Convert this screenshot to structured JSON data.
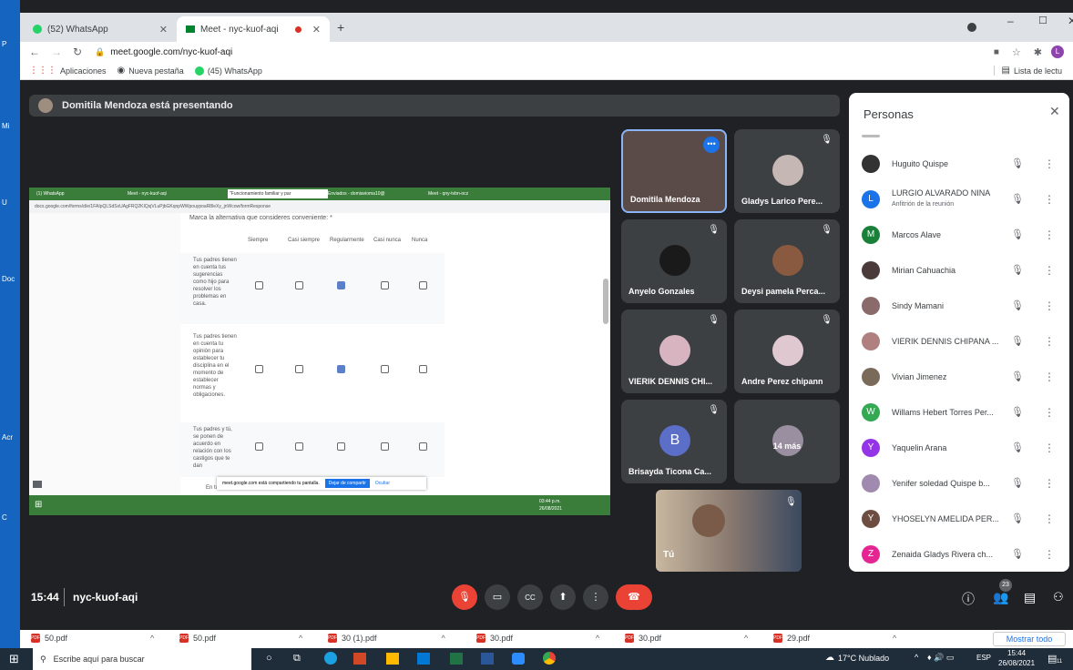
{
  "browser": {
    "tabs": [
      {
        "label": "(52) WhatsApp"
      },
      {
        "label": "Meet - nyc-kuof-aqi"
      }
    ],
    "url": "meet.google.com/nyc-kuof-aqi",
    "bookmarks": [
      "Aplicaciones",
      "Nueva pestaña",
      "(45) WhatsApp"
    ],
    "reading_list": "Lista de lectu"
  },
  "desktop_labels": [
    "P",
    "Mi",
    "U",
    "Doc",
    "Acr",
    "C"
  ],
  "meet": {
    "presenter_banner": "Domitila Mendoza está presentando",
    "meeting_time": "15:44",
    "meeting_code": "nyc-kuof-aqi",
    "participant_count": "23"
  },
  "shared_screen": {
    "tabs": [
      "(1) WhatsApp",
      "Meet - nyc-kuof-aqi",
      "\"Funcionamiento familiar y par",
      "Enviados - domiavioma10@",
      "Meet - qny-tvbn-ocz"
    ],
    "url": "docs.google.com/forms/d/e/1FAIpQLSdSxUAgFRQ2KIQsjVLuPjbGKqnpWWpouypoaR8leXy_jnWcow/formResponse",
    "question": "Marca la alternativa que consideres conveniente: *",
    "columns": [
      "Siempre",
      "Casi siempre",
      "Regularmente",
      "Casi nunca",
      "Nunca"
    ],
    "rows": [
      {
        "text": "Tus padres tienen en cuenta tus sugerencias como hijo para resolver los problemas en casa.",
        "selected": 2
      },
      {
        "text": "Tus padres tienen en cuenta tu opinión para establecer tu disciplina en el momento de establecer normas y obligaciones.",
        "selected": 2
      },
      {
        "text": "Tus padres y tú, se ponen de acuerdo en relación con los castigos que te dan",
        "selected": -1
      }
    ],
    "truncated_text": "En tu ca",
    "sharing_notice": "meet.google.com está compartiendo tu pantalla.",
    "stop_sharing": "Dejar de compartir",
    "hide": "Ocultar",
    "clock": "03:44 p.m.",
    "date": "26/08/2021"
  },
  "tiles": [
    {
      "name": "Domitila Mendoza",
      "col": 0,
      "row": 0,
      "color": "#5a4a48"
    },
    {
      "name": "Gladys Larico Pere...",
      "col": 1,
      "row": 0,
      "color": "#c5b8b4"
    },
    {
      "name": "Anyelo Gonzales",
      "col": 0,
      "row": 1,
      "color": "#1a1a1a"
    },
    {
      "name": "Deysi pamela Perca...",
      "col": 1,
      "row": 1,
      "color": "#8a5a40"
    },
    {
      "name": "VIERIK DENNIS CHI...",
      "col": 0,
      "row": 2,
      "color": "#d8b4c0"
    },
    {
      "name": "Andre Perez chipann",
      "col": 1,
      "row": 2,
      "color": "#e0c8d0"
    },
    {
      "name": "Brisayda Ticona Ca...",
      "col": 0,
      "row": 3,
      "color": "#5b6ec8",
      "initial": "B"
    },
    {
      "name": "14 más",
      "col": 1,
      "row": 3,
      "color": "#9a8fa0"
    }
  ],
  "self_tile": {
    "name": "Tú"
  },
  "people_panel": {
    "title": "Personas",
    "people": [
      {
        "name": "Huguito Quispe",
        "color": "#333",
        "initial": ""
      },
      {
        "name": "LURGIO ALVARADO NINA",
        "sub": "Anfitrión de la reunión",
        "color": "#1a73e8",
        "initial": "L"
      },
      {
        "name": "Marcos Alave",
        "color": "#188038",
        "initial": "M"
      },
      {
        "name": "Mirian Cahuachia",
        "color": "#4a3a3a",
        "initial": ""
      },
      {
        "name": "Sindy Mamani",
        "color": "#8a6a6a",
        "initial": ""
      },
      {
        "name": "VIERIK DENNIS CHIPANA ...",
        "color": "#b08080",
        "initial": ""
      },
      {
        "name": "Vivian Jimenez",
        "color": "#7a6a5a",
        "initial": ""
      },
      {
        "name": "Willams Hebert Torres Per...",
        "color": "#34a853",
        "initial": "W"
      },
      {
        "name": "Yaquelin Arana",
        "color": "#9334e6",
        "initial": "Y"
      },
      {
        "name": "Yenifer soledad Quispe b...",
        "color": "#a08ab0",
        "initial": ""
      },
      {
        "name": "YHOSELYN AMELIDA PER...",
        "color": "#6d4c41",
        "initial": "Y"
      },
      {
        "name": "Zenaida Gladys Rivera ch...",
        "color": "#e52592",
        "initial": "Z"
      }
    ]
  },
  "downloads": {
    "items": [
      "50.pdf",
      "50.pdf",
      "30 (1).pdf",
      "30.pdf",
      "30.pdf",
      "29.pdf"
    ],
    "show_all": "Mostrar todo"
  },
  "taskbar": {
    "search_placeholder": "Escribe aquí para buscar",
    "weather": "17°C  Nublado",
    "lang": "ESP",
    "time": "15:44",
    "date": "26/08/2021",
    "notif_count": "11"
  }
}
